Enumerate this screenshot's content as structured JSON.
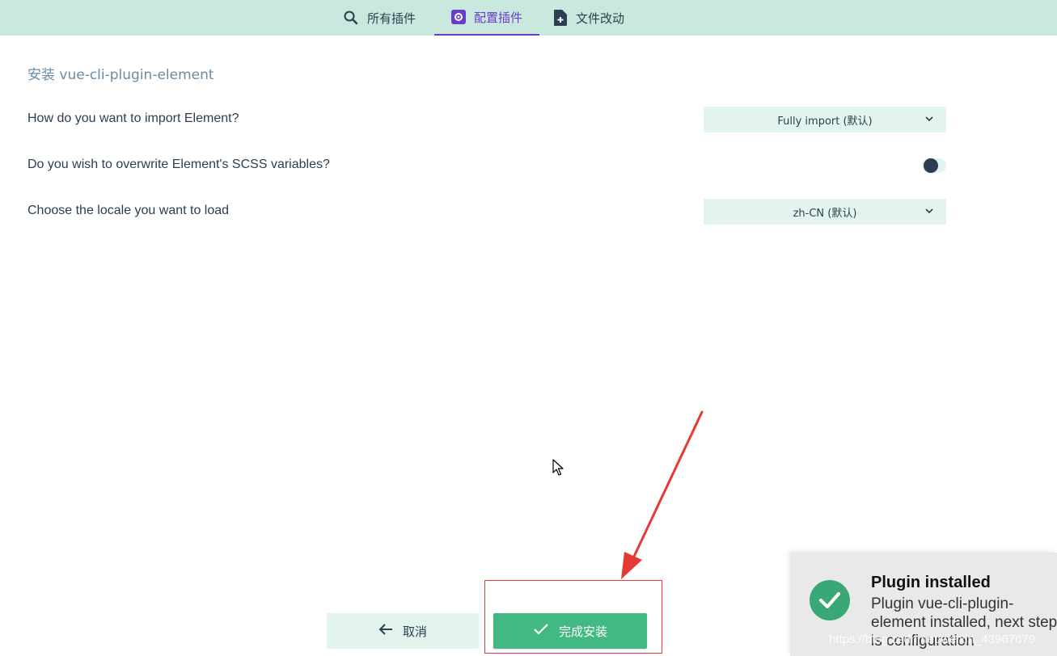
{
  "tabs": [
    {
      "label": "所有插件",
      "icon": "search-icon"
    },
    {
      "label": "配置插件",
      "icon": "settings-icon",
      "active": true
    },
    {
      "label": "文件改动",
      "icon": "file-add-icon"
    }
  ],
  "page": {
    "title": "安装 vue-cli-plugin-element"
  },
  "prompts": [
    {
      "question": "How do you want to import Element?",
      "type": "select",
      "value": "Fully import (默认)"
    },
    {
      "question": "Do you wish to overwrite Element's SCSS variables?",
      "type": "toggle",
      "value": false
    },
    {
      "question": "Choose the locale you want to load",
      "type": "select",
      "value": "zh-CN (默认)"
    }
  ],
  "actions": {
    "cancel_label": "取消",
    "finish_label": "完成安装"
  },
  "toast": {
    "title": "Plugin installed",
    "body": "Plugin vue-cli-plugin-element installed, next step is configuration"
  },
  "watermark": "https://blog.csdn.net/weixin_43967679",
  "colors": {
    "topbar": "#c9e9df",
    "accent": "#6a3cc9",
    "primary": "#42b983",
    "field_bg": "#e3f4ee",
    "annotation": "#e53935"
  }
}
